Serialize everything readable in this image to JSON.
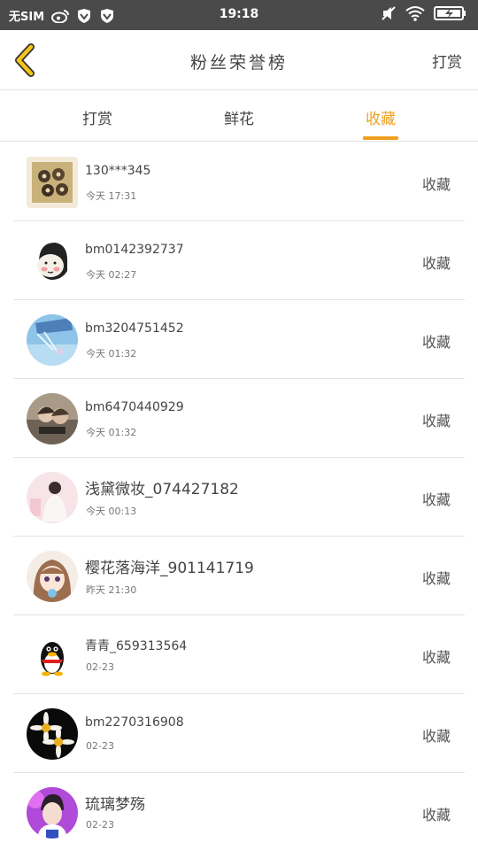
{
  "status_bar": {
    "carrier": "无SIM",
    "time": "19:18"
  },
  "header": {
    "title": "粉丝荣誉榜",
    "action": "打赏"
  },
  "tabs": [
    {
      "label": "打赏"
    },
    {
      "label": "鲜花"
    },
    {
      "label": "收藏"
    }
  ],
  "active_tab": "收藏",
  "colors": {
    "accent": "#f0a020",
    "status_bar": "#4a4a4a",
    "divider": "#e3e3e3"
  },
  "list": [
    {
      "name": "130***345",
      "time": "今天 17:31",
      "action": "收藏"
    },
    {
      "name": "bm0142392737",
      "time": "今天 02:27",
      "action": "收藏"
    },
    {
      "name": "bm3204751452",
      "time": "今天 01:32",
      "action": "收藏"
    },
    {
      "name": "bm6470440929",
      "time": "今天 01:32",
      "action": "收藏"
    },
    {
      "name": "浅黛微妆_074427182",
      "time": "今天 00:13",
      "action": "收藏"
    },
    {
      "name": "樱花落海洋_901141719",
      "time": "昨天 21:30",
      "action": "收藏"
    },
    {
      "name": "青青_659313564",
      "time": "02-23",
      "action": "收藏"
    },
    {
      "name": "bm2270316908",
      "time": "02-23",
      "action": "收藏"
    },
    {
      "name": "琉璃梦殇",
      "time": "02-23",
      "action": "收藏"
    }
  ]
}
